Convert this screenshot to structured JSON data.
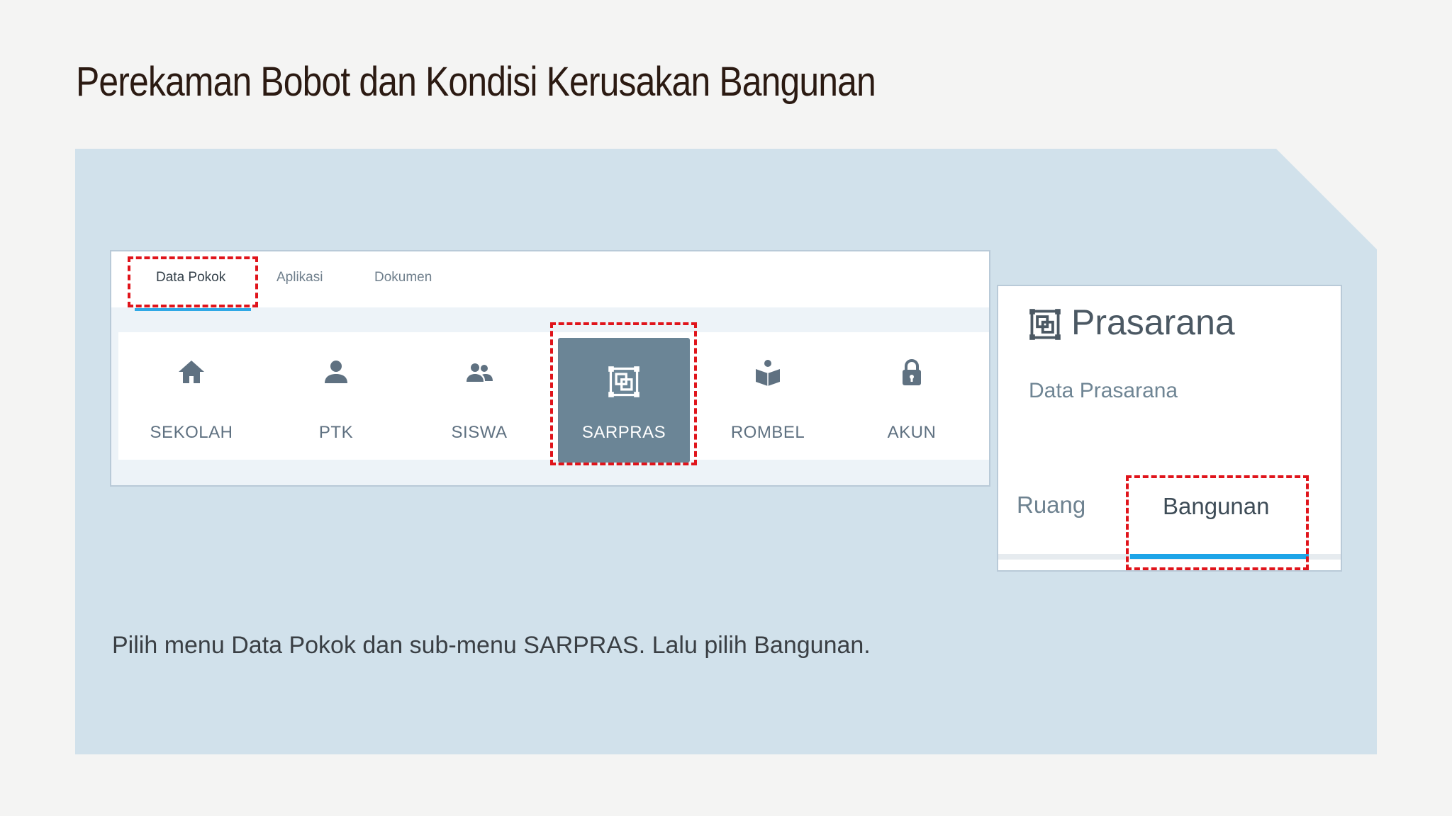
{
  "title": "Perekaman Bobot dan Kondisi Kerusakan Bangunan",
  "top_tabs": [
    "Data Pokok",
    "Aplikasi",
    "Dokumen"
  ],
  "menu_items": [
    {
      "label": "SEKOLAH",
      "icon": "home-icon"
    },
    {
      "label": "PTK",
      "icon": "person-icon"
    },
    {
      "label": "SISWA",
      "icon": "group-icon"
    },
    {
      "label": "SARPRAS",
      "icon": "building-frame-icon"
    },
    {
      "label": "ROMBEL",
      "icon": "reading-person-icon"
    },
    {
      "label": "AKUN",
      "icon": "lock-icon"
    }
  ],
  "active_menu": "SARPRAS",
  "prasarana": {
    "title": "Prasarana",
    "subtitle": "Data Prasarana",
    "tabs": [
      "Ruang",
      "Bangunan"
    ],
    "active_tab": "Bangunan"
  },
  "caption": "Pilih menu Data Pokok dan sub-menu SARPRAS. Lalu pilih Bangunan.",
  "colors": {
    "panel": "#d1e1eb",
    "highlight": "#e0141b",
    "active_menu_bg": "#6b8596",
    "underline": "#1ea5e8"
  }
}
